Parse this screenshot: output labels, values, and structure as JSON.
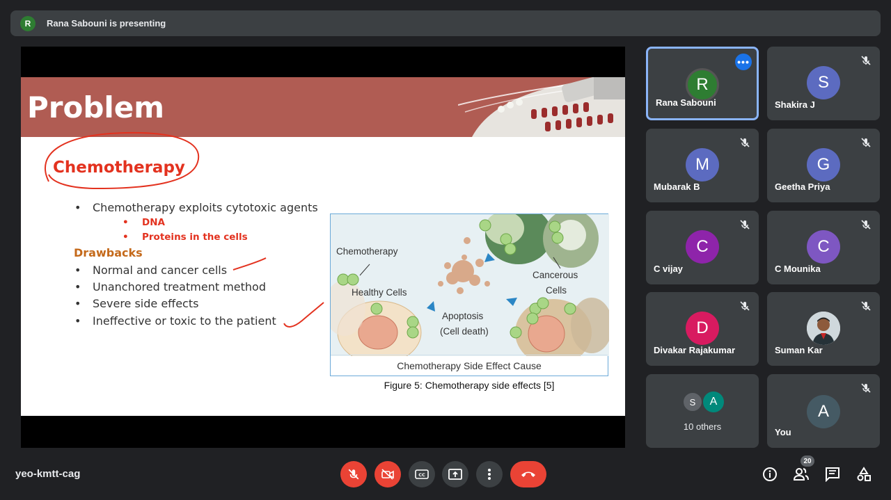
{
  "banner": {
    "avatar_letter": "R",
    "text": "Rana Sabouni is presenting"
  },
  "slide": {
    "title": "Problem",
    "heading": "Chemotherapy",
    "bullet_main": "Chemotherapy exploits cytotoxic agents",
    "sub_bullets": [
      "DNA",
      "Proteins in the cells"
    ],
    "drawbacks_label": "Drawbacks",
    "drawbacks": [
      "Normal and cancer cells",
      "Unanchored treatment method",
      "Severe side effects",
      "Ineffective or toxic to the patient"
    ],
    "figure": {
      "label_chemo": "Chemotherapy",
      "label_healthy": "Healthy Cells",
      "label_apoptosis": "Apoptosis",
      "label_celldeath": "(Cell death)",
      "label_cancerous": "Cancerous",
      "label_cells": "Cells",
      "caption": "Chemotherapy Side Effect Cause"
    },
    "figure_caption": "Figure 5: Chemotherapy side effects [5]"
  },
  "participants": [
    {
      "name": "Rana Sabouni",
      "letter": "R",
      "color": "#2e7d32",
      "muted": false,
      "active": true
    },
    {
      "name": "Shakira J",
      "letter": "S",
      "color": "#5c6bc0",
      "muted": true
    },
    {
      "name": "Mubarak B",
      "letter": "M",
      "color": "#5c6bc0",
      "muted": true
    },
    {
      "name": "Geetha Priya",
      "letter": "G",
      "color": "#5c6bc0",
      "muted": true
    },
    {
      "name": "C vijay",
      "letter": "C",
      "color": "#8e24aa",
      "muted": true
    },
    {
      "name": "C Mounika",
      "letter": "C",
      "color": "#7e57c2",
      "muted": true
    },
    {
      "name": "Divakar Rajakumar",
      "letter": "D",
      "color": "#d81b60",
      "muted": true
    },
    {
      "name": "Suman Kar",
      "letter": "",
      "color": "#8d6e63",
      "muted": true,
      "photo": true
    },
    {
      "name": "10 others",
      "letters": [
        "S",
        "A"
      ],
      "colors": [
        "#5f6368",
        "#00897b"
      ]
    },
    {
      "name": "You",
      "letter": "A",
      "color": "#455a64",
      "muted": true
    }
  ],
  "footer": {
    "meeting_code": "yeo-kmtt-cag",
    "participant_count": "20",
    "icons": [
      "mic-off-icon",
      "camera-off-icon",
      "captions-icon",
      "present-icon",
      "more-icon",
      "end-call-icon",
      "info-icon",
      "people-icon",
      "chat-icon",
      "activities-icon"
    ]
  },
  "colors": {
    "accent": "#8ab4f8",
    "danger": "#ea4335",
    "slide_header": "#b05c53",
    "annotation": "#e3321f"
  }
}
